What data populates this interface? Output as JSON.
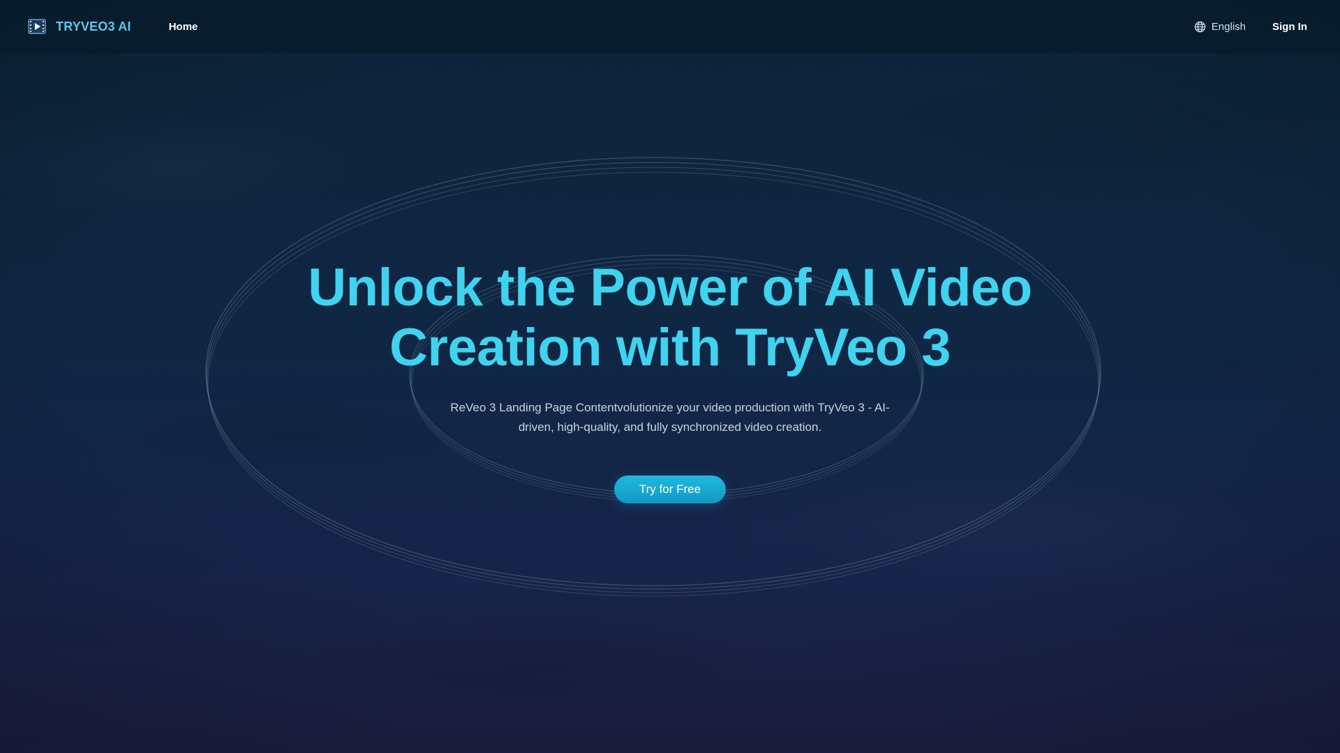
{
  "nav": {
    "brand_name": "TRYVEO3 AI",
    "home_label": "Home",
    "language_label": "English",
    "signin_label": "Sign In"
  },
  "hero": {
    "title_line1": "Unlock the Power of AI Video",
    "title_line2": "Creation with TryVeo 3",
    "subtitle": "ReVeo 3 Landing Page Contentvolutionize your video production with TryVeo 3 - AI-driven, high-quality, and fully synchronized video creation.",
    "cta_label": "Try for Free"
  },
  "icons": {
    "logo": "film-play-icon",
    "language": "globe-icon"
  },
  "colors": {
    "accent": "#3fd3f0",
    "brand": "#5ec8f0",
    "cta": "#1fb9df"
  }
}
